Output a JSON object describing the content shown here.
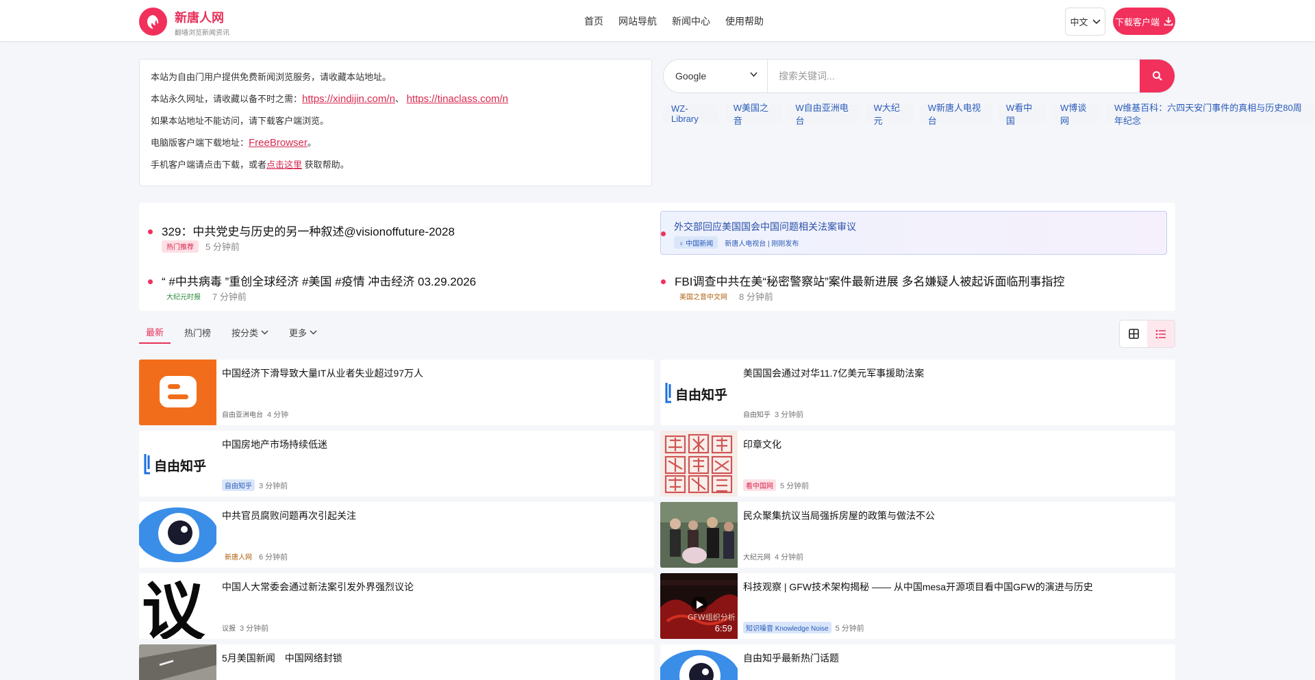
{
  "header": {
    "brand_name": "新唐人网",
    "brand_sub": "翻墙浏览新闻资讯",
    "nav": [
      "首页",
      "网站导航",
      "新闻中心",
      "使用帮助"
    ],
    "lang_label": "中文",
    "download_label": "下载客户端",
    "accent_color": "#f2305c"
  },
  "notice": {
    "line1": "本站为自由门用户提供免费新闻浏览服务，请收藏本站地址。",
    "line2_prefix": "本站永久网址，请收藏以备不时之需：",
    "link1": "https://xindijin.com/n",
    "link2": "https://tinaclass.com/n",
    "link_sep": "、",
    "line3": "如果本站地址不能访问，请下载客户端浏览。",
    "line4_prefix": "电脑版客户端下载地址：",
    "link3": "FreeBrowser",
    "line4_suffix": "。",
    "line5_prefix": "手机客户端请点击下载，或者",
    "link4": "点击这里",
    "line5_suffix": "获取帮助。"
  },
  "search": {
    "engine": "Google",
    "placeholder": "搜索关键词..."
  },
  "tags": [
    "WZ-Library",
    "W美国之音",
    "W自由亚洲电台",
    "W大纪元",
    "W新唐人电视台",
    "W看中国",
    "W博谈网",
    "W维基百科：六四天安门事件的真相与历史80周年纪念"
  ],
  "hot_news": [
    {
      "title": "329：中共党史与历史的另一种叙述@visionoffuture-2028",
      "badge": "热门推荐",
      "time": "5 分钟前"
    },
    {
      "title": "外交部回应美国国会中国问题相关法案审议",
      "badge": "♀ 中国新闻",
      "time": "新唐人电视台 | 刚刚发布"
    },
    {
      "title": "“ #中共病毒 ”重创全球经济 #美国 #疫情 冲击经济 03.29.2026",
      "badge": "大纪元时报",
      "time": "7 分钟前"
    },
    {
      "title": "FBI调查中共在美“秘密警察站”案件最新进展 多名嫌疑人被起诉面临刑事指控",
      "badge": "美国之音中文网",
      "time": "8 分钟前"
    }
  ],
  "tabs": [
    {
      "label": "最新"
    },
    {
      "label": "热门榜"
    },
    {
      "label": "按分类"
    },
    {
      "label": "更多"
    }
  ],
  "articles": [
    {
      "title": "中国经济下滑导致大量IT从业者失业超过97万人",
      "source": "自由亚洲电台",
      "time": "4 分钟",
      "thumb": "blogger"
    },
    {
      "title": "美国国会通过对华11.7亿美元军事援助法案",
      "source": "自由知乎",
      "time": "3 分钟前",
      "thumb": "zhihu"
    },
    {
      "title": "中国房地产市场持续低迷",
      "source": "自由知乎",
      "time": "3 分钟前",
      "thumb": "zhihu"
    },
    {
      "title": "印章文化",
      "source": "看中国网",
      "time": "5 分钟前",
      "thumb": "seal"
    },
    {
      "title": "中共官员腐败问题再次引起关注",
      "source": "新唐人网",
      "time": "6 分钟前",
      "thumb": "eye"
    },
    {
      "title": "民众聚集抗议当局强拆房屋的政策与做法不公",
      "source": "大纪元网",
      "time": "4 分钟前",
      "thumb": "photo"
    },
    {
      "title": "中国人大常委会通过新法案引发外界强烈议论",
      "source": "议报",
      "time": "3 分钟前",
      "thumb": "yi"
    },
    {
      "title": "科技观察 | GFW技术架构揭秘 —— 从中国mesa开源项目看中国GFW的演进与历史",
      "source": "知识噪音 Knowledge Noise",
      "time": "5 分钟前",
      "thumb": "video",
      "duration": "6:59",
      "video_caption": "GFW组织分析"
    },
    {
      "title": "5月美国新闻　中国网络封锁",
      "source": "",
      "time": "",
      "thumb": "road"
    },
    {
      "title": "自由知乎最新热门话题",
      "source": "",
      "time": "",
      "thumb": "eye"
    }
  ]
}
